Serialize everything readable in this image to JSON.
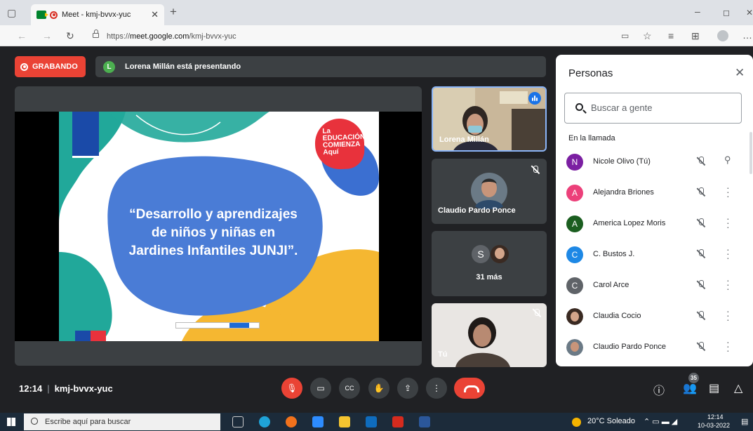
{
  "browser": {
    "tab_title": "Meet - kmj-bvvx-yuc",
    "url_prefix": "https://",
    "url_host": "meet.google.com",
    "url_path": "/kmj-bvvx-yuc"
  },
  "meet": {
    "recording_label": "GRABANDO",
    "presenter_initial": "L",
    "presenting_text": "Lorena Millán está presentando",
    "slide": {
      "title": "“Desarrollo y aprendizajes de niños y niñas en Jardines Infantiles JUNJI”.",
      "badge_lines": [
        "La",
        "EDUCACIÓN",
        "COMIENZA",
        "Aquí"
      ]
    },
    "tiles": {
      "lorena": "Lorena Millán",
      "claudio": "Claudio Pardo Ponce",
      "others_initial": "S",
      "others_count": "31 más",
      "you": "Tú"
    },
    "meeting_time": "12:14",
    "meeting_code": "kmj-bvvx-yuc",
    "participants_count": "35"
  },
  "people_panel": {
    "title": "Personas",
    "search_placeholder": "Buscar a gente",
    "section_label": "En la llamada",
    "people": [
      {
        "initial": "N",
        "name": "Nicole Olivo (Tú)",
        "color": "#7b1fa2"
      },
      {
        "initial": "A",
        "name": "Alejandra Briones",
        "color": "#ec407a"
      },
      {
        "initial": "A",
        "name": "America Lopez Moris",
        "color": "#1b5e20"
      },
      {
        "initial": "C",
        "name": "C. Bustos J.",
        "color": "#1e88e5"
      },
      {
        "initial": "C",
        "name": "Carol Arce",
        "color": "#5f6368"
      },
      {
        "initial": "",
        "name": "Claudia Cocio",
        "color": "#6d4c41"
      },
      {
        "initial": "",
        "name": "Claudio Pardo Ponce",
        "color": "#8d6e63"
      }
    ]
  },
  "taskbar": {
    "search_placeholder": "Escribe aquí para buscar",
    "weather": "20°C Soleado",
    "time": "12:14",
    "date": "10-03-2022"
  }
}
